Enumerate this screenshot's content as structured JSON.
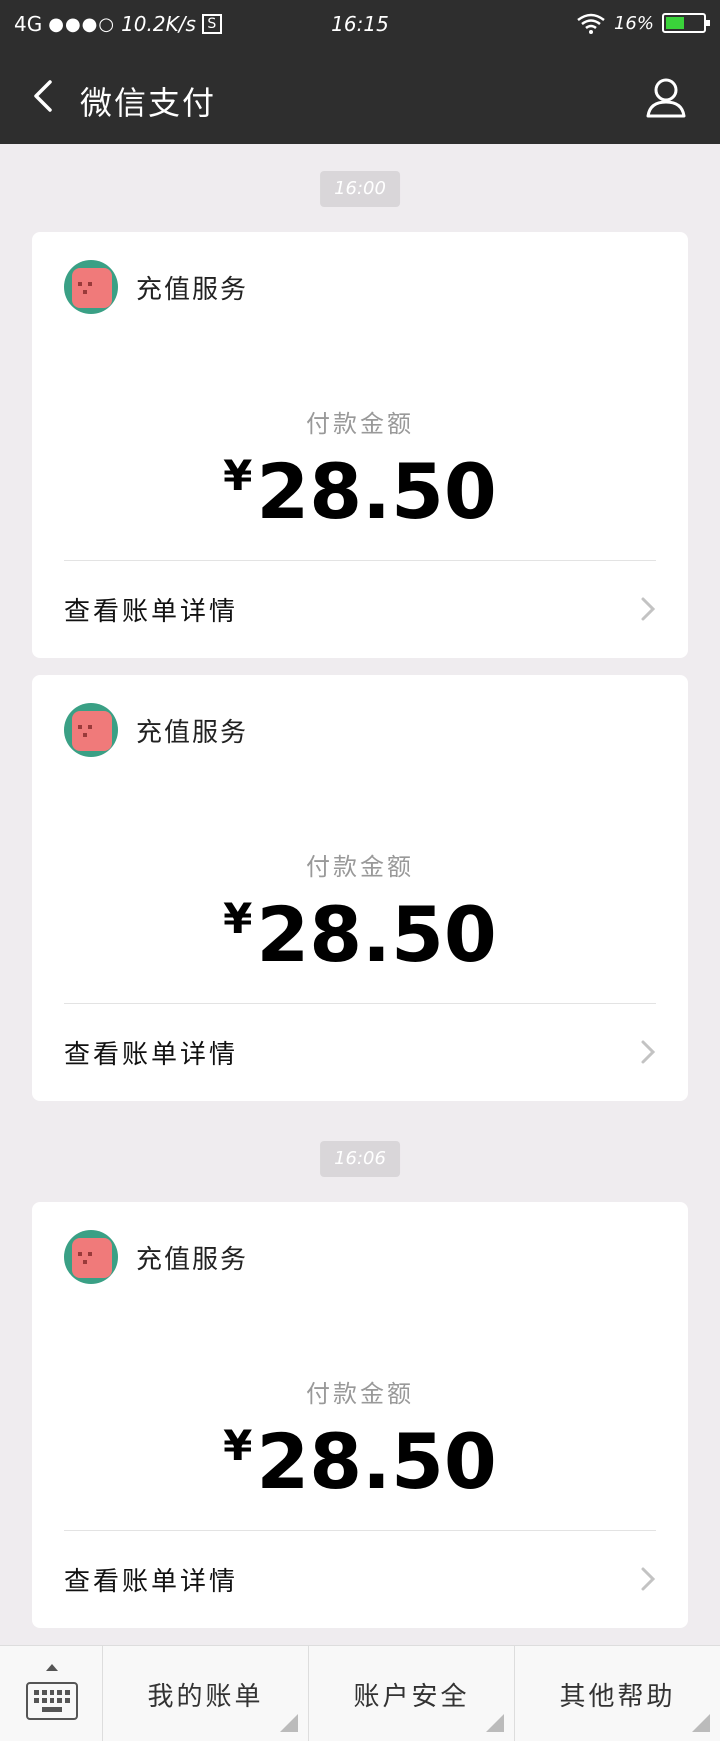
{
  "status_bar": {
    "network": "4G",
    "signal_dots": "●●●○",
    "speed": "10.2K/s",
    "s_badge": "S",
    "time": "16:15",
    "battery": "16%",
    "battery_level_percent": 16
  },
  "nav": {
    "title": "微信支付"
  },
  "groups": [
    {
      "time": "16:00",
      "cards": [
        {
          "merchant": "充值服务",
          "amount_label": "付款金额",
          "currency": "¥",
          "amount": "28.50",
          "detail_label": "查看账单详情"
        },
        {
          "merchant": "充值服务",
          "amount_label": "付款金额",
          "currency": "¥",
          "amount": "28.50",
          "detail_label": "查看账单详情"
        }
      ]
    },
    {
      "time": "16:06",
      "cards": [
        {
          "merchant": "充值服务",
          "amount_label": "付款金额",
          "currency": "¥",
          "amount": "28.50",
          "detail_label": "查看账单详情"
        }
      ]
    }
  ],
  "bottom_menu": {
    "items": [
      {
        "label": "我的账单"
      },
      {
        "label": "账户安全"
      },
      {
        "label": "其他帮助"
      }
    ]
  },
  "colors": {
    "header_bg": "#2e2e2e",
    "page_bg": "#efecef",
    "card_bg": "#ffffff",
    "battery_fill": "#3ad23a",
    "avatar_bg": "#3aa085",
    "avatar_pig": "#f07a7a"
  },
  "icons": {
    "back": "chevron-left-icon",
    "user": "user-icon",
    "detail": "chevron-right-icon",
    "keyboard": "keyboard-icon"
  }
}
